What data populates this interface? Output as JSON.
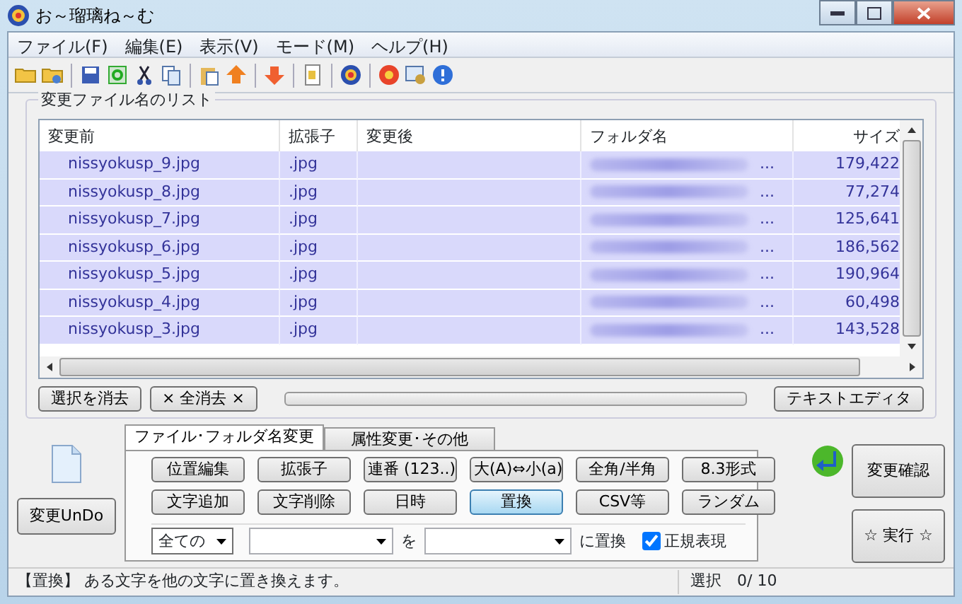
{
  "window": {
    "title": "お～瑠璃ね～む"
  },
  "menu": [
    {
      "label": "ファイル(F)"
    },
    {
      "label": "編集(E)"
    },
    {
      "label": "表示(V)"
    },
    {
      "label": "モード(M)"
    },
    {
      "label": "ヘルプ(H)"
    }
  ],
  "list_group": {
    "title": "変更ファイル名のリスト"
  },
  "table": {
    "columns": [
      "変更前",
      "拡張子",
      "変更後",
      "フォルダ名",
      "サイズ"
    ],
    "rows": [
      {
        "name": "nissyokusp_9.jpg",
        "ext": ".jpg",
        "folder": "...",
        "size": "179,422",
        "selected": true
      },
      {
        "name": "nissyokusp_8.jpg",
        "ext": ".jpg",
        "folder": "...",
        "size": "77,274",
        "selected": true
      },
      {
        "name": "nissyokusp_7.jpg",
        "ext": ".jpg",
        "folder": "...",
        "size": "125,641",
        "selected": true
      },
      {
        "name": "nissyokusp_6.jpg",
        "ext": ".jpg",
        "folder": "...",
        "size": "186,562",
        "selected": true
      },
      {
        "name": "nissyokusp_5.jpg",
        "ext": ".jpg",
        "folder": "...",
        "size": "190,964",
        "selected": true
      },
      {
        "name": "nissyokusp_4.jpg",
        "ext": ".jpg",
        "folder": "...",
        "size": "60,498",
        "selected": true
      },
      {
        "name": "nissyokusp_3.jpg",
        "ext": ".jpg",
        "folder": "...",
        "size": "143,528",
        "selected": true
      }
    ]
  },
  "list_buttons": {
    "clear_selection": "選択を消去",
    "clear_all": "× 全消去 ×",
    "text_editor": "テキストエディタ"
  },
  "progress": {
    "level": 0
  },
  "undo_button": "変更UnDo",
  "tabs": [
    {
      "label": "ファイル･フォルダ名変更",
      "selected": true
    },
    {
      "label": "属性変更･その他",
      "selected": false
    }
  ],
  "modes": [
    {
      "label": "位置編集",
      "selected": false
    },
    {
      "label": "拡張子",
      "selected": false
    },
    {
      "label": "連番 (123..)",
      "selected": false
    },
    {
      "label": "大(A)⇔小(a)",
      "selected": false
    },
    {
      "label": "全角/半角",
      "selected": false
    },
    {
      "label": "8.3形式",
      "selected": false
    },
    {
      "label": "文字追加",
      "selected": false
    },
    {
      "label": "文字削除",
      "selected": false
    },
    {
      "label": "日時",
      "selected": false
    },
    {
      "label": "置換",
      "selected": true
    },
    {
      "label": "CSV等",
      "selected": false
    },
    {
      "label": "ランダム",
      "selected": false
    }
  ],
  "replace_row": {
    "scope": "全ての",
    "connector": "を",
    "suffix": "に置換",
    "regex": {
      "label": "正規表現",
      "checked": true
    }
  },
  "confirm_button": "変更確認",
  "run_button": "☆ 実行 ☆",
  "status_bar": {
    "message": "【置換】 ある文字を他の文字に置き換えます。",
    "selection": "選択　0/ 10"
  }
}
